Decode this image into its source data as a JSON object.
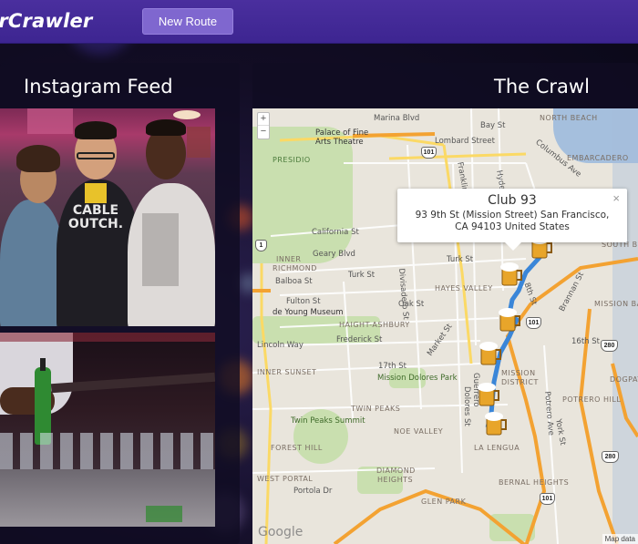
{
  "app": {
    "brand": "arCrawler",
    "new_route_label": "New Route"
  },
  "feed": {
    "title": "Instagram Feed",
    "shirt_text": "CABLE\nOUTCH."
  },
  "crawl": {
    "title": "The Crawl"
  },
  "map": {
    "zoom_in": "+",
    "zoom_out": "−",
    "popup": {
      "title": "Club 93",
      "address_line1": "93 9th St (Mission Street) San Francisco,",
      "address_line2": "CA 94103 United States",
      "close": "×"
    },
    "google": "Google",
    "map_data": "Map data",
    "labels": {
      "marina": "Marina Blvd",
      "bay": "Bay St",
      "north_beach": "NORTH BEACH",
      "palace": "Palace of Fine",
      "palace2": "Arts Theatre",
      "lombard": "Lombard Street",
      "columbus": "Columbus Ave",
      "presidio": "PRESIDIO",
      "embarcadero": "EMBARCADERO",
      "franklin": "Franklin",
      "hyde": "Hyde",
      "california": "California St",
      "geary": "Geary Blvd",
      "turk": "Turk St",
      "turk2": "Turk St",
      "inner_richmond": "INNER",
      "inner_richmond2": "RICHMOND",
      "balboa": "Balboa St",
      "divisadero": "Divisadero St",
      "fulton": "Fulton St",
      "oak": "Oak St",
      "hayes_valley": "HAYES VALLEY",
      "de_young": "de Young Museum",
      "haight": "HAIGHT-ASHBURY",
      "lincoln": "Lincoln Way",
      "frederick": "Frederick St",
      "market": "Market St",
      "inner_sunset": "INNER SUNSET",
      "seventeenth": "17th St",
      "mission_dolores": "Mission Dolores Park",
      "mission": "MISSION",
      "district": "DISTRICT",
      "twin_peaks": "TWIN PEAKS",
      "twin_peaks_summit": "Twin Peaks Summit",
      "noe": "NOE VALLEY",
      "guerrero": "Guerrero",
      "dolores": "Dolores St",
      "potrero_ave": "Potrero Ave",
      "potrero_hill": "POTRERO HILL",
      "dogpatch": "DOGPATCH",
      "brannan": "Brannan St",
      "south_beach": "SOUTH BE",
      "mission_bay": "MISSION BA",
      "sixteenth": "16th St",
      "forest_hill": "FOREST HILL",
      "la_lengua": "LA LENGUA",
      "west_portal": "WEST PORTAL",
      "diamond": "DIAMOND",
      "heights": "HEIGHTS",
      "portola": "Portola Dr",
      "glen_park": "GLEN PARK",
      "bernal": "BERNAL HEIGHTS",
      "eighth": "8th St",
      "york": "York St",
      "h101": "101",
      "h101b": "101",
      "h101c": "101",
      "h1": "1",
      "h280": "280",
      "h280b": "280"
    }
  },
  "colors": {
    "nav": "#4a2f9e",
    "button": "#7f67cf",
    "route": "#3a86d8",
    "freeway": "#f3a232",
    "arterial": "#fbd965"
  }
}
